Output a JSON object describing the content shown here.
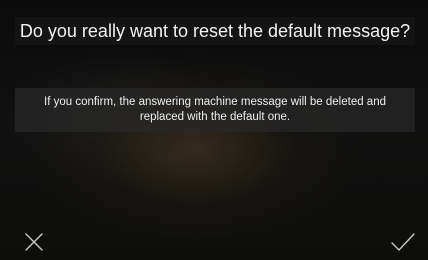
{
  "dialog": {
    "title": "Do you really want to reset the default message?",
    "message": "If you confirm, the answering machine message will be deleted and replaced with the default one."
  },
  "actions": {
    "cancel_icon": "close-icon",
    "confirm_icon": "checkmark-icon"
  },
  "colors": {
    "background": "#0d0d0d",
    "title_bar": "#141414",
    "message_box": "#282828",
    "text": "#ffffff",
    "icon_stroke": "#cfcfcf"
  }
}
